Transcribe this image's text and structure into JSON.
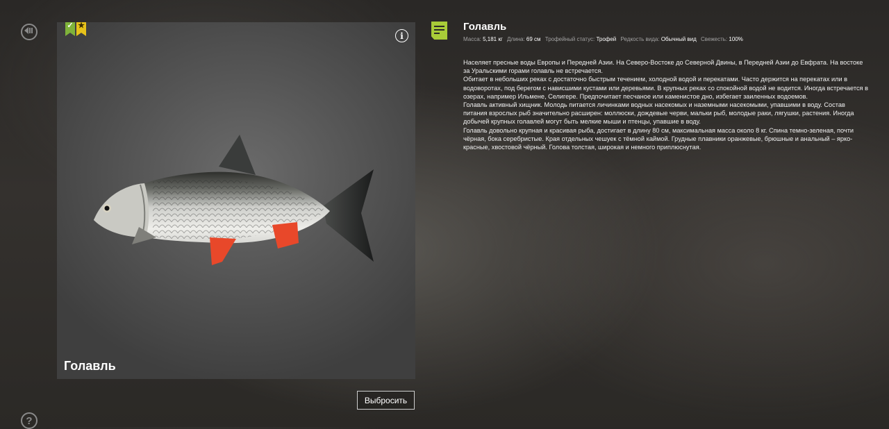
{
  "nav": {
    "back_icon": "back-arrow-icon",
    "help_icon": "question-mark-icon",
    "help_label": "?"
  },
  "card": {
    "badges": [
      {
        "icon": "check-icon",
        "symbol": "✓",
        "color": "#7fb33a"
      },
      {
        "icon": "star-icon",
        "symbol": "★",
        "color": "#e7c21a"
      }
    ],
    "info_label": "i",
    "name": "Голавль"
  },
  "discard_label": "Выбросить",
  "details": {
    "title": "Голавль",
    "stats": [
      {
        "label": "Масса:",
        "value": "5,181 кг"
      },
      {
        "label": "Длина:",
        "value": "69 см"
      },
      {
        "label": "Трофейный статус:",
        "value": "Трофей"
      },
      {
        "label": "Редкость вида:",
        "value": "Обычный вид"
      },
      {
        "label": "Свежесть:",
        "value": "100%"
      }
    ],
    "description": [
      "Населяет пресные воды Европы и Передней Азии. На Северо-Востоке до Северной Двины, в Передней Азии до Евфрата. На востоке за Уральскими горами голавль не встречается.",
      "Обитает в небольших реках с достаточно быстрым течением, холодной водой и перекатами. Часто держится на перекатах или в водоворотах, под берегом с нависшими кустами или деревьями. В крупных реках со спокойной водой не водится. Иногда встречается в озерах, например Ильмене, Селигере. Предпочитает песчаное или каменистое дно, избегает заиленных водоемов.",
      "Голавль активный хищник. Молодь питается личинками водных насекомых и наземными насекомыми, упавшими в воду. Состав питания взрослых рыб значительно расширен: моллюски, дождевые черви, мальки рыб, молодые раки, лягушки, растения. Иногда добычей крупных голавлей могут быть мелкие мыши и птенцы, упавшие в воду.",
      "Голавль довольно крупная и красивая рыба, достигает в длину 80 см, максимальная масса около 8 кг. Спина темно-зеленая, почти чёрная, бока серебристые. Края отдельных чешуек с тёмной каймой. Грудные плавники оранжевые, брюшные и анальный – ярко-красные, хвостовой чёрный. Голова толстая, широкая и немного приплюснутая."
    ]
  },
  "colors": {
    "accent_green": "#a8cc38",
    "fin_red": "#e8482a"
  }
}
